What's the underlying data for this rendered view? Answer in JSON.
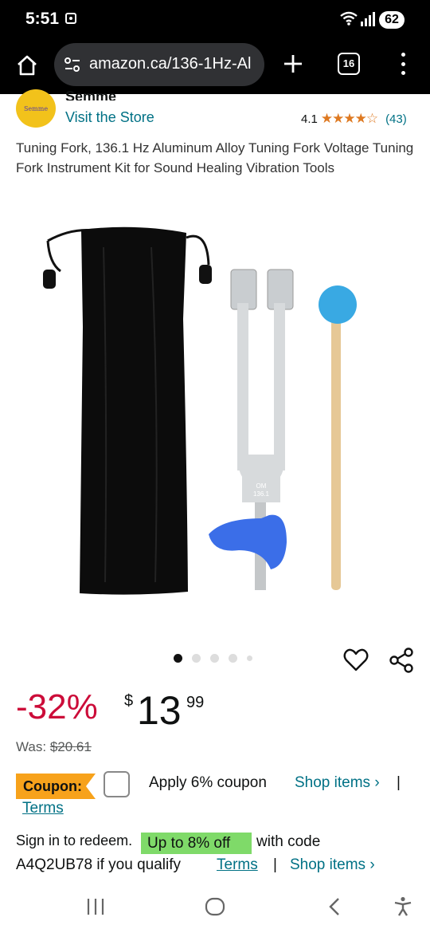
{
  "status_bar": {
    "time": "5:51",
    "battery": "62"
  },
  "browser": {
    "url": "amazon.ca/136-1Hz-Al",
    "tab_count": "16"
  },
  "store": {
    "logo_text": "Semme",
    "name": "Semme",
    "visit_label": "Visit the Store",
    "rating_value": "4.1",
    "stars": "★★★★☆",
    "rating_count": "(43)"
  },
  "product": {
    "title": "Tuning Fork, 136.1 Hz Aluminum Alloy Tuning Fork Voltage Tuning Fork Instrument Kit for Sound Healing Vibration Tools",
    "fork_engraving_1": "OM",
    "fork_engraving_2": "136.1"
  },
  "carousel": {
    "count": 5,
    "active_index": 0
  },
  "price": {
    "discount": "-32%",
    "currency": "$",
    "whole": "13",
    "fraction": "99",
    "was_label": "Was:",
    "was_price": "$20.61"
  },
  "coupon": {
    "badge": "Coupon:",
    "text": "Apply 6% coupon",
    "shop_label": "Shop items ›",
    "separator": "|",
    "terms": "Terms"
  },
  "promo": {
    "signin": "Sign in to redeem.",
    "highlight": "Up to 8% off",
    "with_code": "with code",
    "code_line": "A4Q2UB78 if you qualify",
    "terms": "Terms",
    "separator": "|",
    "shop_label": "Shop items ›"
  },
  "colors": {
    "link": "#007185",
    "discount": "#cc0c39",
    "coupon_badge": "#f7a21b",
    "promo_highlight": "#7fda69",
    "stars": "#de7921"
  }
}
